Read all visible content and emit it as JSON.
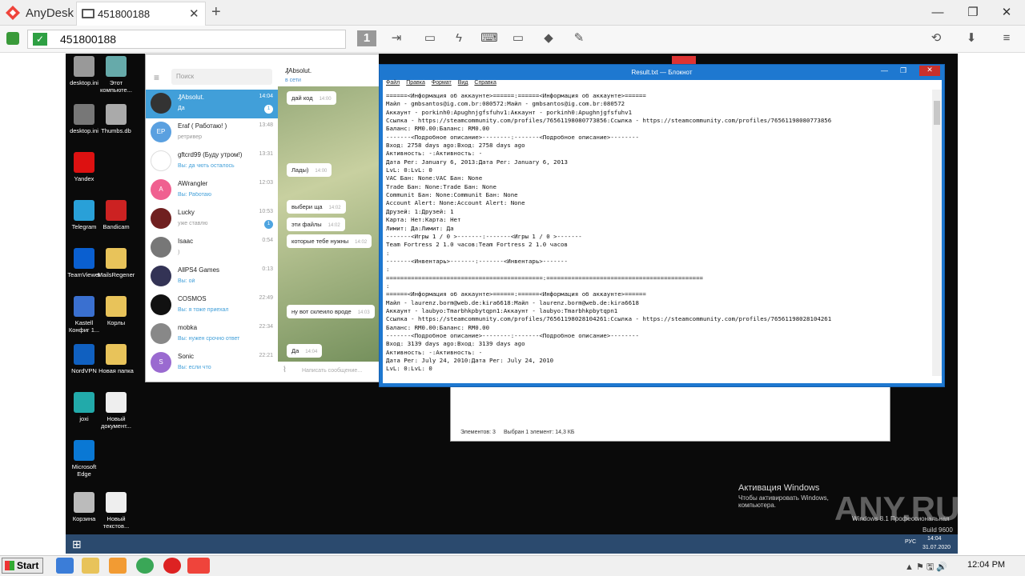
{
  "anydesk": {
    "app_name": "AnyDesk",
    "tab_title": "451800188",
    "address": "451800188",
    "window_controls": {
      "minimize": "—",
      "maximize": "❐",
      "close": "✕"
    }
  },
  "desktop_icons": [
    {
      "label": "desktop.ini"
    },
    {
      "label": "Этот компьюте..."
    },
    {
      "label": "desktop.ini"
    },
    {
      "label": "Thumbs.db"
    },
    {
      "label": "Yandex"
    },
    {
      "label": "Telegram"
    },
    {
      "label": "Bandicam"
    },
    {
      "label": "TeamViewer"
    },
    {
      "label": "MailsRegener"
    },
    {
      "label": "Kastell Конфиг 1..."
    },
    {
      "label": "Корлы"
    },
    {
      "label": "NordVPN"
    },
    {
      "label": "Новая папка"
    },
    {
      "label": "joxi"
    },
    {
      "label": "Новый документ..."
    },
    {
      "label": "Microsoft Edge"
    },
    {
      "label": "Корзина"
    },
    {
      "label": "Новый текстов..."
    }
  ],
  "telegram": {
    "search_placeholder": "Поиск",
    "header_name": "₰Absolut.",
    "header_status": "в сети",
    "compose_placeholder": "Написать сообщение...",
    "chats": [
      {
        "name": "₰Absolut.",
        "msg": "Да",
        "time": "14:04",
        "badge": "1",
        "color": "#333"
      },
      {
        "name": "Eraf ( Работаю! )",
        "msg": "ретривер",
        "time": "13:48",
        "badge": "",
        "color": "#5aa0e0",
        "initials": "EP"
      },
      {
        "name": "gftcrd99 (Буду утром!)",
        "msg": "Вы: да чють осталось",
        "time": "13:31",
        "badge": "",
        "color": "#fff"
      },
      {
        "name": "AWrangler",
        "msg": "Вы: Работаю",
        "time": "12:03",
        "badge": "",
        "color": "#f06090",
        "initials": "A"
      },
      {
        "name": "Lucky",
        "msg": "уже ставлю",
        "time": "10:53",
        "badge": "1",
        "color": "#702020"
      },
      {
        "name": "Isaac",
        "msg": ")",
        "time": "0:54",
        "badge": "",
        "color": "#777"
      },
      {
        "name": "AllPS4 Games",
        "msg": "Вы: ой",
        "time": "0:13",
        "badge": "",
        "color": "#335"
      },
      {
        "name": "COSMOS",
        "msg": "Вы: я тоже приехал",
        "time": "22:49",
        "badge": "",
        "color": "#111"
      },
      {
        "name": "mobka",
        "msg": "Вы: нужен срочно ответ",
        "time": "22:34",
        "badge": "",
        "color": "#888"
      },
      {
        "name": "Sonic",
        "msg": "Вы: если что",
        "time": "22:21",
        "badge": "",
        "color": "#9a6ad0",
        "initials": "S"
      }
    ],
    "bubbles": [
      {
        "text": "дай код",
        "time": "14:00"
      },
      {
        "text": "Лады)",
        "time": "14:00"
      },
      {
        "text": "выбери ща",
        "time": "14:02"
      },
      {
        "text": "эти файлы",
        "time": "14:02"
      },
      {
        "text": "которые тебе нужны",
        "time": "14:02"
      },
      {
        "text": "ну вот склеило вроде",
        "time": "14:03"
      },
      {
        "text": "Да",
        "time": "14:04"
      }
    ]
  },
  "notepad": {
    "title": "Result.txt — Блокнот",
    "menu": [
      "Файл",
      "Правка",
      "Формат",
      "Вид",
      "Справка"
    ],
    "lines": [
      "======<Информация об аккаунте>======:======<Информация об аккаунте>======",
      "Майл - gmbsantos@ig.com.br:080572:Майл - gmbsantos@ig.com.br:080572",
      "Аккаунт - porkinh0:Apughnjgfsfuhv1:Аккаунт - porkinh0:Apughnjgfsfuhv1",
      "Ссылка - https://steamcommunity.com/profiles/76561198080773856:Ссылка - https://steamcommunity.com/profiles/76561198080773856",
      "Баланс: RM0.00:Баланс: RM0.00",
      "-------<Подробное описание>--------:-------<Подробное описание>--------",
      "Вход: 2758 days ago:Вход: 2758 days ago",
      "Активность: -:Активность: -",
      "Дата Рег: January 6, 2013:Дата Рег: January 6, 2013",
      "LvL: 0:LvL: 0",
      "VAC Бан: None:VAC Бан: None",
      "Trade Бан: None:Trade Бан: None",
      "Communit Бан: None:Communit Бан: None",
      "Account Alert: None:Account Alert: None",
      "Друзей: 1:Друзей: 1",
      "Карта: Нет:Карта: Нет",
      "Лимит: Да:Лимит: Да",
      "-------<Игры 1 / 0 >-------:-------<Игры 1 / 0 >-------",
      "Team Fortress 2 1.0 часов:Team Fortress 2 1.0 часов",
      ":",
      "-------<Инвентарь>-------:-------<Инвентарь>-------",
      ":",
      "============================================:============================================",
      ":",
      "======<Информация об аккаунте>======:======<Информация об аккаунте>======",
      "Майл - laurenz.borm@web.de:kira6618:Майл - laurenz.borm@web.de:kira6618",
      "Аккаунт - laubyo:Tmarbhkpbytqpn1:Аккаунт - laubyo:Tmarbhkpbytqpn1",
      "Ссылка - https://steamcommunity.com/profiles/76561198028104261:Ссылка - https://steamcommunity.com/profiles/76561198028104261",
      "Баланс: RM0.00:Баланс: RM0.00",
      "-------<Подробное описание>--------:-------<Подробное описание>--------",
      "Вход: 3139 days ago:Вход: 3139 days ago",
      "Активность: -:Активность: -",
      "Дата Рег: July 24, 2010:Дата Рег: July 24, 2010",
      "LvL: 0:LvL: 0"
    ]
  },
  "explorer_status": {
    "items": "Элементов: 3",
    "selected": "Выбран 1 элемент: 14,3 КБ"
  },
  "watermark": {
    "activate_title": "Активация Windows",
    "activate_text": "Чтобы активировать Windows, компьютера.",
    "edition": "Windows 8.1 Профессиональная",
    "build": "Build 9600",
    "brand": "ANY.RUN"
  },
  "remote_tray": {
    "lang": "РУС",
    "time": "14:04",
    "date": "31.07.2020"
  },
  "local_taskbar": {
    "start": "Start",
    "time": "12:04 PM"
  }
}
